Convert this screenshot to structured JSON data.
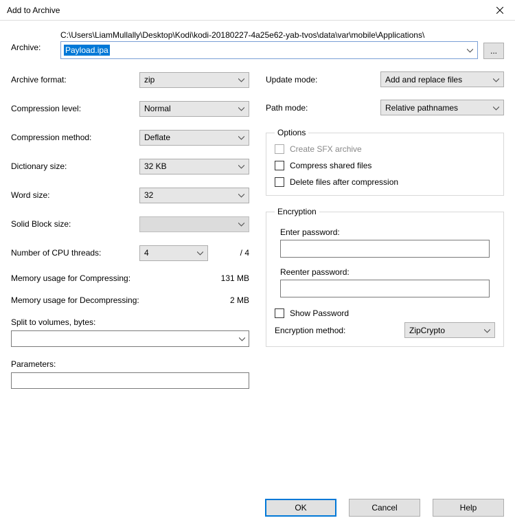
{
  "title": "Add to Archive",
  "archive": {
    "label": "Archive:",
    "path": "C:\\Users\\LiamMullally\\Desktop\\Kodi\\kodi-20180227-4a25e62-yab-tvos\\data\\var\\mobile\\Applications\\",
    "filename": "Payload.ipa",
    "browse": "..."
  },
  "left": {
    "format": {
      "label": "Archive format:",
      "value": "zip"
    },
    "level": {
      "label": "Compression level:",
      "value": "Normal"
    },
    "method": {
      "label": "Compression method:",
      "value": "Deflate"
    },
    "dict": {
      "label": "Dictionary size:",
      "value": "32 KB"
    },
    "word": {
      "label": "Word size:",
      "value": "32"
    },
    "solid": {
      "label": "Solid Block size:",
      "value": ""
    },
    "cpu": {
      "label": "Number of CPU threads:",
      "value": "4",
      "max": "/ 4"
    },
    "memc": {
      "label": "Memory usage for Compressing:",
      "value": "131 MB"
    },
    "memd": {
      "label": "Memory usage for Decompressing:",
      "value": "2 MB"
    },
    "split": {
      "label": "Split to volumes, bytes:",
      "value": ""
    },
    "params": {
      "label": "Parameters:",
      "value": ""
    }
  },
  "right": {
    "update": {
      "label": "Update mode:",
      "value": "Add and replace files"
    },
    "pathmode": {
      "label": "Path mode:",
      "value": "Relative pathnames"
    },
    "options": {
      "legend": "Options",
      "sfx": "Create SFX archive",
      "shared": "Compress shared files",
      "del": "Delete files after compression"
    },
    "enc": {
      "legend": "Encryption",
      "enter": "Enter password:",
      "reenter": "Reenter password:",
      "show": "Show Password",
      "method_label": "Encryption method:",
      "method_value": "ZipCrypto"
    }
  },
  "buttons": {
    "ok": "OK",
    "cancel": "Cancel",
    "help": "Help"
  }
}
